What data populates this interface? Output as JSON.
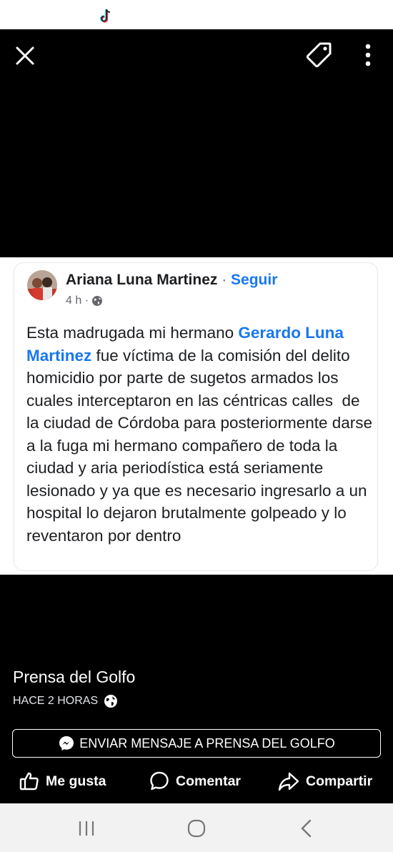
{
  "post": {
    "author": "Ariana Luna Martinez",
    "separator": " · ",
    "follow_label": "Seguir",
    "time": "4 h ·",
    "text_before": "Esta madrugada mi hermano ",
    "mention": "Gerardo Luna Martinez",
    "text_after": " fue víctima de la comisión del delito homicidio por parte de sugetos armados los cuales interceptaron en las céntricas calles  de la ciudad de Córdoba para posteriormente darse a la fuga mi hermano compañero de toda la ciudad y aria periodística está seriamente lesionado y ya que es necesario ingresarlo a un hospital lo dejaron brutalmente golpeado y lo reventaron por dentro"
  },
  "page": {
    "name": "Prensa del Golfo",
    "time": "HACE 2 HORAS"
  },
  "message_button": "ENVIAR MENSAJE A PRENSA DEL GOLFO",
  "actions": {
    "like": "Me gusta",
    "comment": "Comentar",
    "share": "Compartir"
  }
}
